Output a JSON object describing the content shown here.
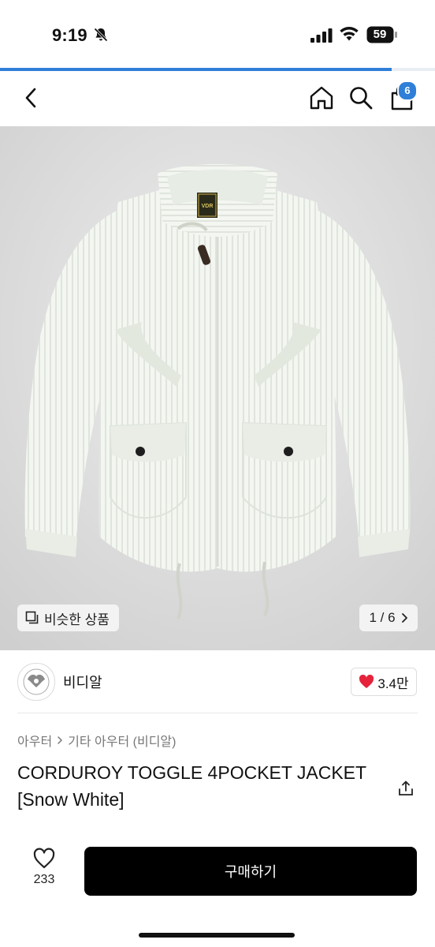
{
  "status_bar": {
    "time": "9:19",
    "battery": "59"
  },
  "page_load_progress": 0.9,
  "nav": {
    "cart_count": "6"
  },
  "image": {
    "similar_label": "비슷한 상품",
    "page_indicator": "1 / 6"
  },
  "seller": {
    "name": "비디알",
    "likes": "3.4만"
  },
  "breadcrumb": {
    "category": "아우터",
    "subcategory": "기타 아우터 (비디알)"
  },
  "product": {
    "title": "CORDUROY TOGGLE 4POCKET JACKET [Snow White]"
  },
  "bottom": {
    "wish_count": "233",
    "buy_label": "구매하기"
  },
  "logo": {
    "text": "VDR"
  },
  "colors": {
    "accent": "#2f7fd8",
    "heart": "#e5233b",
    "buy": "#000000"
  },
  "icons": [
    "bell-slash-icon",
    "signal-icon",
    "wifi-icon",
    "battery-icon",
    "back-icon",
    "home-icon",
    "search-icon",
    "bag-icon",
    "similar-icon",
    "chevron-right-icon",
    "heart-icon",
    "share-icon",
    "heart-outline-icon"
  ]
}
